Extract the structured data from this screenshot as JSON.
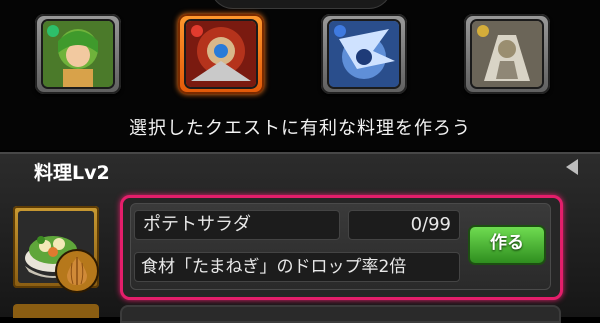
{
  "hint_text": "選択したクエストに有利な料理を作ろう",
  "section_title": "料理Lv2",
  "recipe": {
    "name": "ポテトサラダ",
    "count": "0/99",
    "effect": "食材「たまねぎ」のドロップ率2倍",
    "make_label": "作る"
  },
  "quests": [
    {
      "icon": "green-haired-character-icon",
      "selected": false
    },
    {
      "icon": "red-machine-character-icon",
      "selected": true
    },
    {
      "icon": "blue-dragon-character-icon",
      "selected": false
    },
    {
      "icon": "silver-mech-character-icon",
      "selected": false
    }
  ],
  "colors": {
    "highlight": "#e41e6b",
    "selected_quest": "#f2741a",
    "make_button": "#4ab536"
  }
}
